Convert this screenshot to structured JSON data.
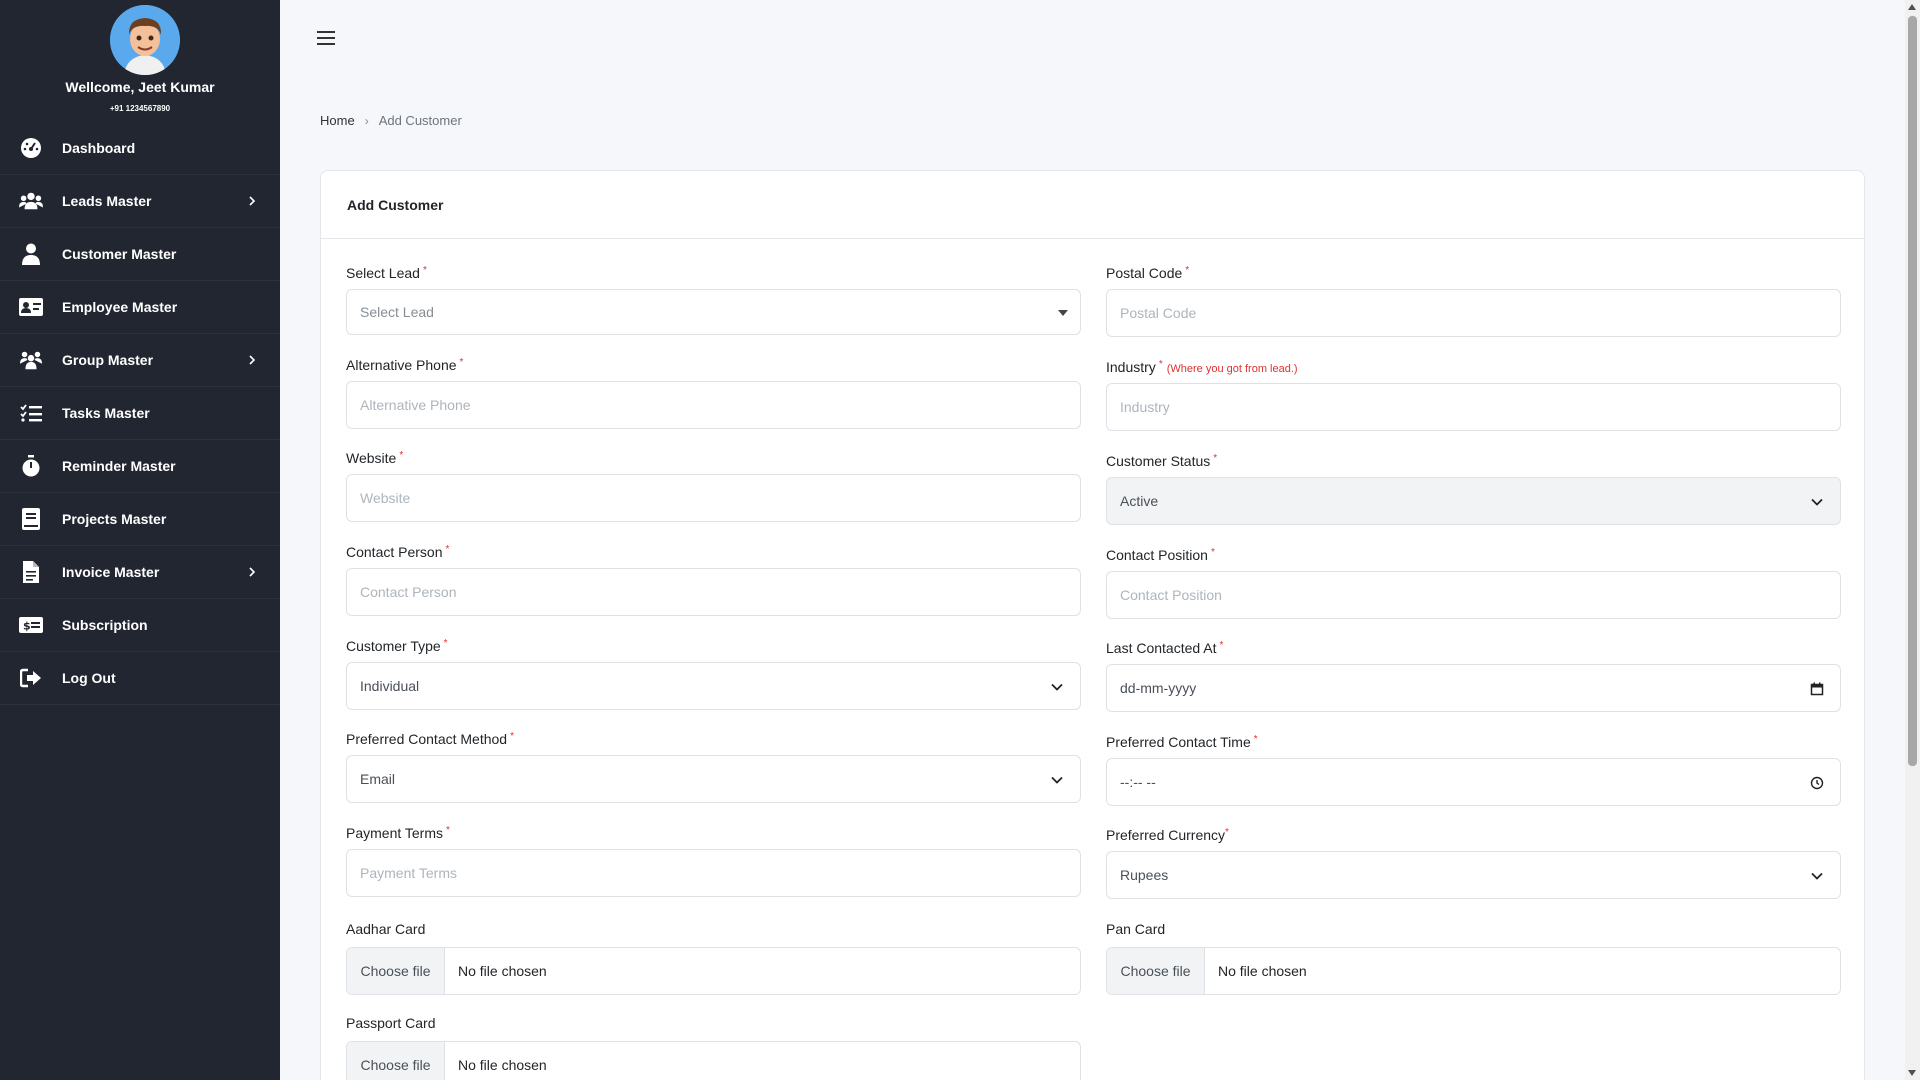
{
  "profile": {
    "welcome": "Wellcome, Jeet Kumar",
    "phone": "+91 1234567890"
  },
  "nav": [
    {
      "label": "Dashboard",
      "icon": "dashboard-icon",
      "chevron": false
    },
    {
      "label": "Leads Master",
      "icon": "users-icon",
      "chevron": true
    },
    {
      "label": "Customer Master",
      "icon": "user-icon",
      "chevron": false
    },
    {
      "label": "Employee Master",
      "icon": "id-card-icon",
      "chevron": false
    },
    {
      "label": "Group Master",
      "icon": "group-icon",
      "chevron": true
    },
    {
      "label": "Tasks Master",
      "icon": "task-list-icon",
      "chevron": false
    },
    {
      "label": "Reminder Master",
      "icon": "stopwatch-icon",
      "chevron": false
    },
    {
      "label": "Projects Master",
      "icon": "book-icon",
      "chevron": false
    },
    {
      "label": "Invoice Master",
      "icon": "file-icon",
      "chevron": true
    },
    {
      "label": "Subscription",
      "icon": "money-bill-icon",
      "chevron": false
    },
    {
      "label": "Log Out",
      "icon": "logout-icon",
      "chevron": false
    }
  ],
  "breadcrumb": {
    "home": "Home",
    "separator": "›",
    "current": "Add Customer"
  },
  "card": {
    "title": "Add Customer"
  },
  "form": {
    "select_lead": {
      "label": "Select Lead",
      "placeholder": "Select Lead"
    },
    "postal_code": {
      "label": "Postal Code",
      "placeholder": "Postal Code"
    },
    "alt_phone": {
      "label": "Alternative Phone",
      "placeholder": "Alternative Phone"
    },
    "industry": {
      "label": "Industry",
      "note": "(Where you got from lead.)",
      "placeholder": "Industry"
    },
    "website": {
      "label": "Website",
      "placeholder": "Website"
    },
    "customer_status": {
      "label": "Customer Status",
      "value": "Active"
    },
    "contact_person": {
      "label": "Contact Person",
      "placeholder": "Contact Person"
    },
    "contact_position": {
      "label": "Contact Position",
      "placeholder": "Contact Position"
    },
    "customer_type": {
      "label": "Customer Type",
      "value": "Individual"
    },
    "last_contacted": {
      "label": "Last Contacted At",
      "placeholder": "dd-mm-yyyy"
    },
    "preferred_method": {
      "label": "Preferred Contact Method",
      "value": "Email"
    },
    "preferred_time": {
      "label": "Preferred Contact Time",
      "placeholder": "--:-- --"
    },
    "payment_terms": {
      "label": "Payment Terms",
      "placeholder": "Payment Terms"
    },
    "preferred_currency": {
      "label": "Preferred Currency",
      "value": "Rupees"
    },
    "aadhar": {
      "label": "Aadhar Card",
      "button": "Choose file",
      "status": "No file chosen"
    },
    "pan": {
      "label": "Pan Card",
      "button": "Choose file",
      "status": "No file chosen"
    },
    "passport": {
      "label": "Passport Card",
      "button": "Choose file",
      "status": "No file chosen"
    },
    "required_mark": "*"
  },
  "colors": {
    "sidebar_bg": "#212631",
    "required": "#e03131",
    "page_bg": "#f5f7fa"
  }
}
